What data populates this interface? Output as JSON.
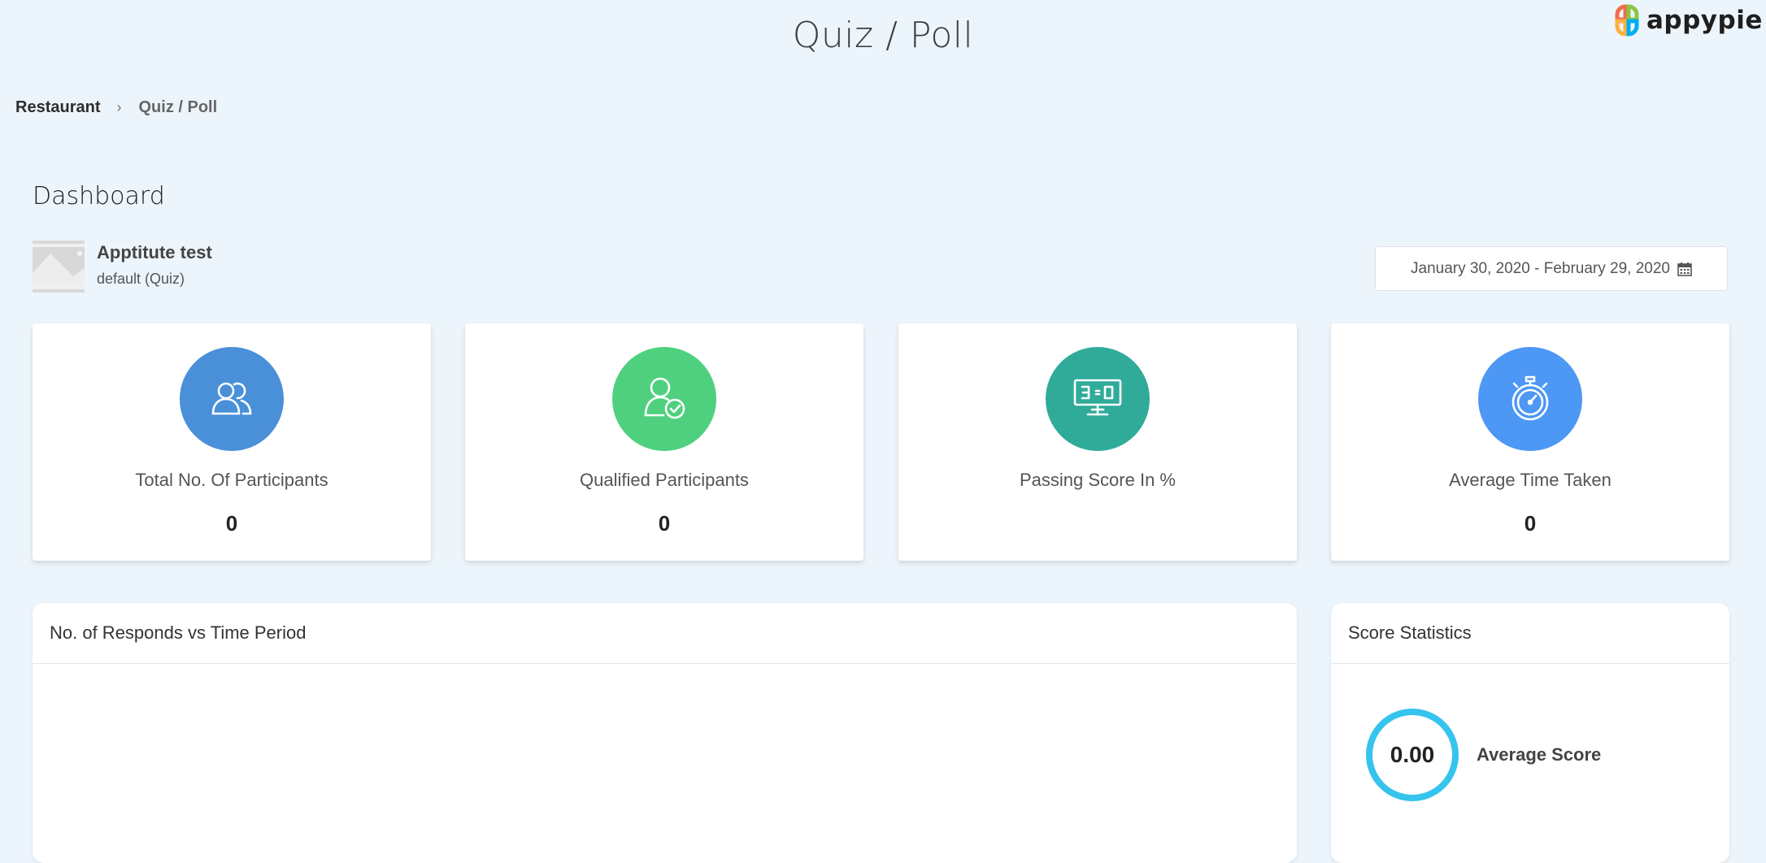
{
  "header": {
    "title": "Quiz / Poll",
    "logo_text": "appypie",
    "logo_colors": [
      "#f26c4f",
      "#8cc63f",
      "#00aeef",
      "#fbb040"
    ]
  },
  "breadcrumb": {
    "root": "Restaurant",
    "separator": "›",
    "current": "Quiz / Poll"
  },
  "dashboard": {
    "title": "Dashboard",
    "quiz": {
      "name": "Apptitute test",
      "type": "default (Quiz)"
    },
    "date_range": {
      "value": "January 30, 2020 - February 29, 2020",
      "icon": "calendar-icon"
    }
  },
  "stats": [
    {
      "label": "Total No. Of Participants",
      "value": "0",
      "icon": "users-icon",
      "color": "#4a90d9"
    },
    {
      "label": "Qualified Participants",
      "value": "0",
      "icon": "user-check-icon",
      "color": "#4fd07f"
    },
    {
      "label": "Passing Score In %",
      "value": "",
      "icon": "scoreboard-icon",
      "color": "#30ab9a"
    },
    {
      "label": "Average Time Taken",
      "value": "0",
      "icon": "stopwatch-icon",
      "color": "#4d97f5"
    }
  ],
  "panels": {
    "responses": {
      "title": "No. of Responds vs Time Period"
    },
    "score": {
      "title": "Score Statistics",
      "average_score": "0.00",
      "average_label": "Average Score",
      "ring_color": "#35c4ee"
    }
  }
}
